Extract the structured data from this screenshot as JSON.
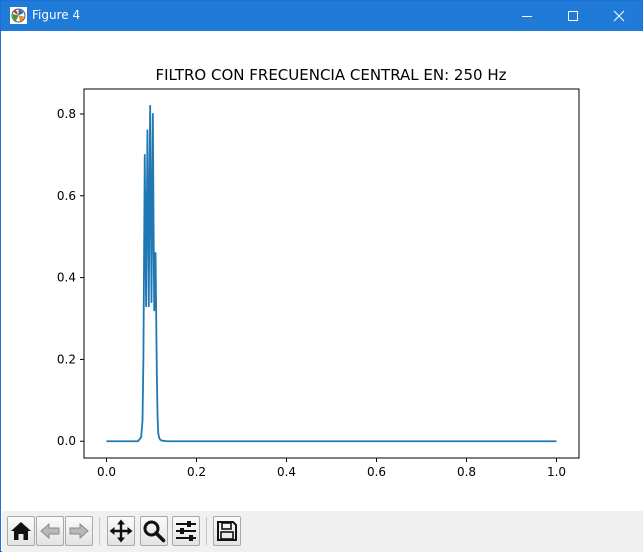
{
  "window": {
    "title": "Figure 4",
    "controls": {
      "minimize": "minimize-icon",
      "maximize": "maximize-icon",
      "close": "close-icon"
    }
  },
  "toolbar": {
    "buttons": [
      "home-icon",
      "back-arrow-icon",
      "forward-arrow-icon",
      "pan-move-icon",
      "zoom-magnifier-icon",
      "configure-subplots-icon",
      "save-floppy-icon"
    ]
  },
  "colors": {
    "titlebar": "#1f7ad8",
    "line": "#1f77b4"
  },
  "chart_data": {
    "type": "line",
    "title": "FILTRO CON FRECUENCIA CENTRAL EN:  250 Hz",
    "xlabel": "",
    "ylabel": "",
    "xlim": [
      -0.05,
      1.05
    ],
    "ylim": [
      -0.041,
      0.861
    ],
    "xticks": [
      0.0,
      0.2,
      0.4,
      0.6,
      0.8,
      1.0
    ],
    "xtick_labels": [
      "0.0",
      "0.2",
      "0.4",
      "0.6",
      "0.8",
      "1.0"
    ],
    "yticks": [
      0.0,
      0.2,
      0.4,
      0.6,
      0.8
    ],
    "ytick_labels": [
      "0.0",
      "0.2",
      "0.4",
      "0.6",
      "0.8"
    ],
    "grid": false,
    "series": [
      {
        "x": [
          0.0,
          0.07,
          0.077,
          0.08,
          0.082,
          0.0835,
          0.085,
          0.0865,
          0.088,
          0.0895,
          0.091,
          0.0925,
          0.094,
          0.0955,
          0.097,
          0.0985,
          0.1,
          0.1015,
          0.103,
          0.1045,
          0.106,
          0.1075,
          0.109,
          0.1105,
          0.112,
          0.1135,
          0.115,
          0.117,
          0.12,
          0.125,
          0.135,
          1.0
        ],
        "y": [
          0.0,
          0.0,
          0.01,
          0.05,
          0.2,
          0.45,
          0.7,
          0.5,
          0.33,
          0.55,
          0.76,
          0.55,
          0.33,
          0.6,
          0.82,
          0.6,
          0.34,
          0.56,
          0.8,
          0.55,
          0.32,
          0.4,
          0.46,
          0.3,
          0.15,
          0.06,
          0.02,
          0.008,
          0.003,
          0.001,
          0.0,
          0.0
        ]
      }
    ]
  }
}
